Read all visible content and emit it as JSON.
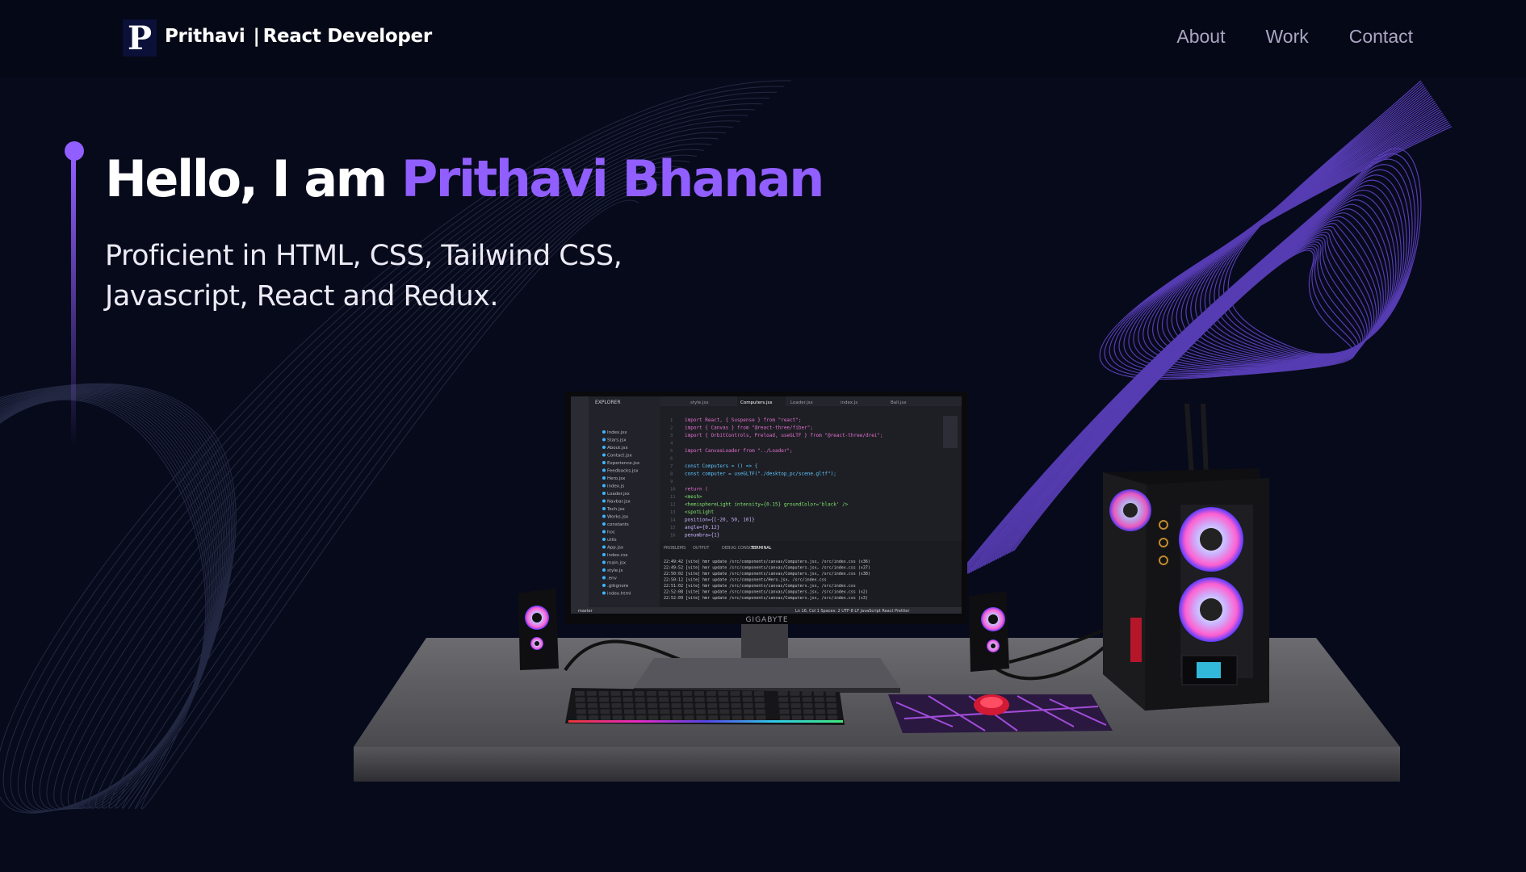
{
  "navbar": {
    "logo_letter": "P",
    "name": "Prithavi",
    "separator": "|",
    "role": "React Developer",
    "links": [
      {
        "label": "About"
      },
      {
        "label": "Work"
      },
      {
        "label": "Contact"
      }
    ]
  },
  "hero": {
    "greeting": "Hello, I am ",
    "name": "Prithavi Bhanan",
    "subtitle_line1": "Proficient in HTML, CSS, Tailwind CSS,",
    "subtitle_line2": "Javascript, React and Redux."
  },
  "scene": {
    "monitor_brand": "GIGABYTE",
    "editor": {
      "tabs": [
        "style.jsx",
        "Computers.jsx",
        "Loader.jsx",
        "index.js",
        "Ball.jsx"
      ],
      "explorer_title": "EXPLORER",
      "files": [
        "Index.jsx",
        "Stars.jsx",
        "About.jsx",
        "Contact.jsx",
        "Experience.jsx",
        "Feedbacks.jsx",
        "Hero.jsx",
        "index.js",
        "Loader.jsx",
        "Navbar.jsx",
        "Tech.jsx",
        "Works.jsx",
        "constants",
        "hoc",
        "utils",
        "App.jsx",
        "index.css",
        "main.jsx",
        "style.js",
        ".env",
        ".gitignore",
        "index.html"
      ],
      "code_lines": [
        "import React, { Suspense } from \"react\";",
        "import { Canvas } from \"@react-three/fiber\";",
        "import { OrbitControls, Preload, useGLTF } from \"@react-three/drei\";",
        "",
        "import CanvasLoader from \"../Loader\";",
        "",
        "const Computers = () => {",
        "  const computer = useGLTF(\"./desktop_pc/scene.gltf\");",
        "",
        "  return (",
        "    <mesh>",
        "      <hemisphereLight intensity={0.15} groundColor='black' />",
        "      <spotLight",
        "        position={[-20, 50, 10]}",
        "        angle={0.12}",
        "        penumbra={1}"
      ],
      "panel_tabs": [
        "PROBLEMS",
        "OUTPUT",
        "DEBUG CONSOLE",
        "TERMINAL"
      ],
      "terminal_lines": [
        "22:49:42 [vite] hmr update /src/components/canvas/Computers.jsx, /src/index.css (x36)",
        "22:49:52 [vite] hmr update /src/components/canvas/Computers.jsx, /src/index.css (x37)",
        "22:50:02 [vite] hmr update /src/components/canvas/Computers.jsx, /src/index.css (x38)",
        "22:50:12 [vite] hmr update /src/components/Hero.jsx, /src/index.css",
        "22:51:02 [vite] hmr update /src/components/canvas/Computers.jsx, /src/index.css",
        "22:52:08 [vite] hmr update /src/components/canvas/Computers.jsx, /src/index.css (x2)",
        "22:52:09 [vite] hmr update /src/components/canvas/Computers.jsx, /src/index.css (x3)"
      ],
      "status_left": "master",
      "status_right": "Ln 16, Col 1   Spaces: 2   UTF-8   LF   JavaScript React   Prettier"
    }
  },
  "colors": {
    "accent": "#915eff",
    "background": "#070a1b",
    "nav_text": "#aaa6c3"
  }
}
